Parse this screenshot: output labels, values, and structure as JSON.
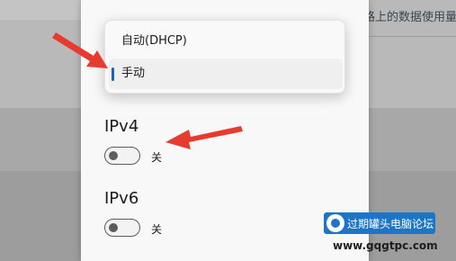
{
  "background": {
    "text_line": "路上的数据使用量",
    "link_text": ""
  },
  "dropdown": {
    "options": [
      {
        "label": "自动(DHCP)"
      },
      {
        "label": "手动",
        "selected": true
      }
    ]
  },
  "ipv4": {
    "title": "IPv4",
    "toggle_state": "关"
  },
  "ipv6": {
    "title": "IPv6",
    "toggle_state": "关"
  },
  "watermark": {
    "title": "过期罐头电脑论坛",
    "url": "www.gqgtpc.com"
  },
  "colors": {
    "accent": "#1a64b3",
    "arrow": "#e83b30",
    "watermark_bg": "#1d75c8"
  }
}
